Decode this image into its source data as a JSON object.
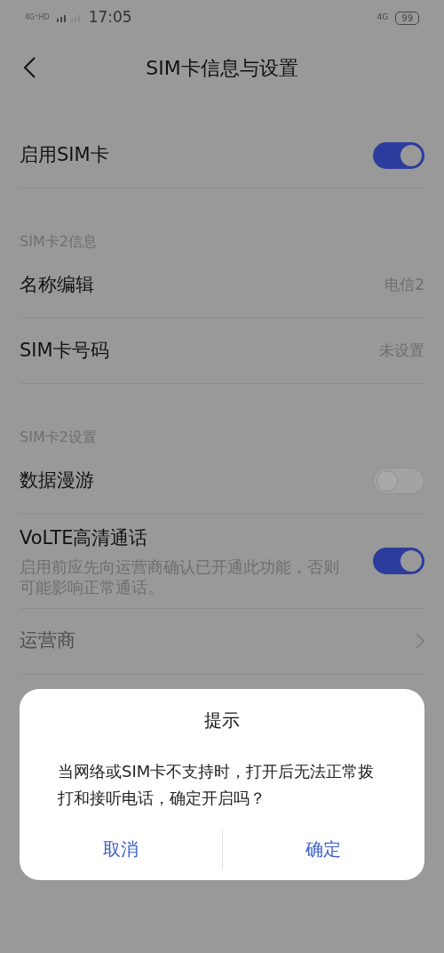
{
  "status_bar": {
    "network": "4G⁺HD",
    "time": "17:05",
    "data": "4G",
    "battery": "99"
  },
  "header": {
    "title": "SIM卡信息与设置"
  },
  "sections": [
    {
      "items": [
        {
          "kind": "toggle",
          "label": "启用SIM卡",
          "on": true,
          "disabled": false
        }
      ]
    },
    {
      "title": "SIM卡2信息",
      "items": [
        {
          "kind": "value",
          "label": "名称编辑",
          "value": "电信2",
          "disabled": false
        },
        {
          "kind": "value",
          "label": "SIM卡号码",
          "value": "未设置",
          "disabled": false
        }
      ]
    },
    {
      "title": "SIM卡2设置",
      "items": [
        {
          "kind": "toggle",
          "label": "数据漫游",
          "on": false,
          "disabled": false
        },
        {
          "kind": "toggle",
          "label": "VoLTE高清通话",
          "description": "启用前应先向运营商确认已开通此功能，否则可能影响正常通话。",
          "on": true,
          "disabled": false
        },
        {
          "kind": "nav",
          "label": "运营商",
          "disabled": true
        }
      ]
    }
  ],
  "dialog": {
    "title": "提示",
    "message": "当网络或SIM卡不支持时，打开后无法正常拨打和接听电话，确定开启吗？",
    "buttons": [
      "取消",
      "确定"
    ]
  }
}
